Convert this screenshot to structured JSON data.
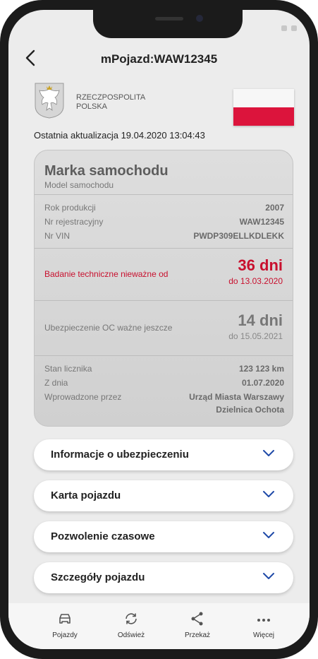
{
  "nav": {
    "back_icon": "chevron-left-icon",
    "title": "mPojazd:WAW12345"
  },
  "header": {
    "country_line1": "RZECZPOSPOLITA",
    "country_line2": "POLSKA"
  },
  "last_update": "Ostatnia aktualizacja 19.04.2020 13:04:43",
  "card": {
    "brand": "Marka samochodu",
    "model": "Model samochodu",
    "production_year_label": "Rok produkcji",
    "production_year": "2007",
    "registration_label": "Nr rejestracyjny",
    "registration": "WAW12345",
    "vin_label": "Nr VIN",
    "vin": "PWDP309ELLKDLEKK",
    "inspection_label": "Badanie techniczne nieważne od",
    "inspection_days": "36 dni",
    "inspection_date": "do 13.03.2020",
    "insurance_label": "Ubezpieczenie OC ważne jeszcze",
    "insurance_days": "14 dni",
    "insurance_date": "do 15.05.2021",
    "mileage_label": "Stan licznika",
    "mileage": "123 123 km",
    "date_label": "Z dnia",
    "date": "01.07.2020",
    "entered_by_label": "Wprowadzone przez",
    "entered_by_line1": "Urząd Miasta Warszawy",
    "entered_by_line2": "Dzielnica Ochota"
  },
  "accordions": [
    {
      "label": "Informacje o ubezpieczeniu"
    },
    {
      "label": "Karta pojazdu"
    },
    {
      "label": "Pozwolenie czasowe"
    },
    {
      "label": "Szczegóły pojazdu"
    }
  ],
  "tabbar": [
    {
      "label": "Pojazdy",
      "icon": "car-icon"
    },
    {
      "label": "Odśwież",
      "icon": "refresh-icon"
    },
    {
      "label": "Przekaż",
      "icon": "share-icon"
    },
    {
      "label": "Więcej",
      "icon": "more-icon"
    }
  ],
  "colors": {
    "alert": "#c8102e",
    "accent": "#1f4aa8",
    "flag_red": "#dc143c"
  }
}
